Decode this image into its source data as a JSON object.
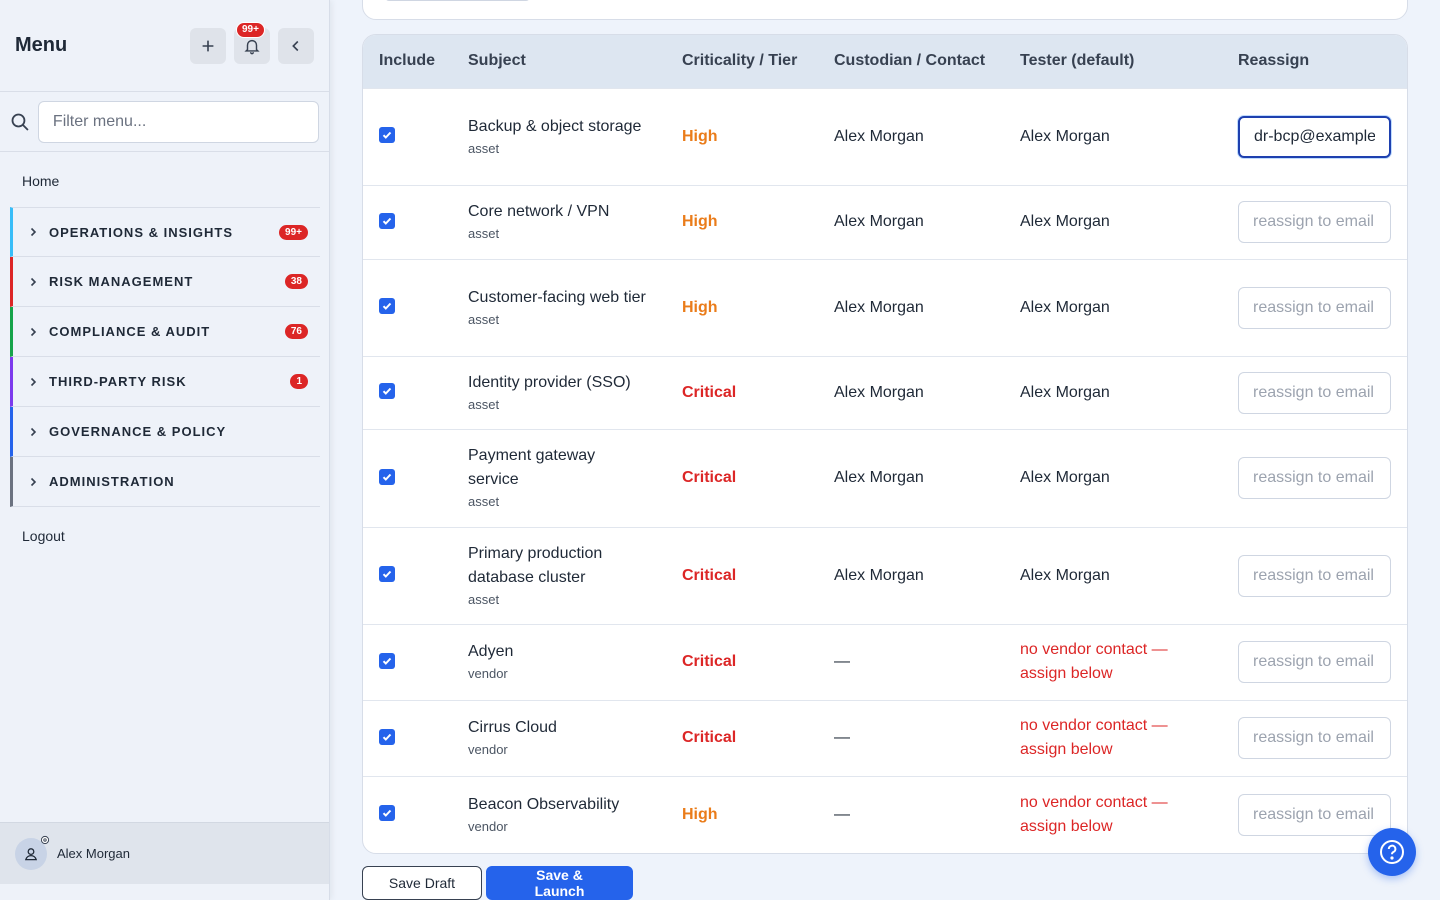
{
  "sidebar": {
    "title": "Menu",
    "notification_badge": "99+",
    "search_placeholder": "Filter menu...",
    "home_label": "Home",
    "logout_label": "Logout",
    "groups": [
      {
        "label": "OPERATIONS & INSIGHTS",
        "badge": "99+",
        "color": "#38bdf8"
      },
      {
        "label": "RISK MANAGEMENT",
        "badge": "38",
        "color": "#dc2626"
      },
      {
        "label": "COMPLIANCE & AUDIT",
        "badge": "76",
        "color": "#16a34a"
      },
      {
        "label": "THIRD-PARTY RISK",
        "badge": "1",
        "color": "#7c3aed"
      },
      {
        "label": "GOVERNANCE & POLICY",
        "badge": "",
        "color": "#2563eb"
      },
      {
        "label": "ADMINISTRATION",
        "badge": "",
        "color": "#6b7280"
      }
    ],
    "user_name": "Alex Morgan"
  },
  "table": {
    "headers": [
      "Include",
      "Subject",
      "Criticality / Tier",
      "Custodian / Contact",
      "Tester (default)",
      "Reassign"
    ],
    "reassign_placeholder": "reassign to email",
    "rows": [
      {
        "included": true,
        "subject": "Backup & object storage",
        "type": "asset",
        "tier": "High",
        "custodian": "Alex Morgan",
        "tester": "Alex Morgan",
        "tester_warning": false,
        "reassign_value": "dr-bcp@example.com"
      },
      {
        "included": true,
        "subject": "Core network / VPN",
        "type": "asset",
        "tier": "High",
        "custodian": "Alex Morgan",
        "tester": "Alex Morgan",
        "tester_warning": false,
        "reassign_value": ""
      },
      {
        "included": true,
        "subject": "Customer-facing web tier",
        "type": "asset",
        "tier": "High",
        "custodian": "Alex Morgan",
        "tester": "Alex Morgan",
        "tester_warning": false,
        "reassign_value": ""
      },
      {
        "included": true,
        "subject": "Identity provider (SSO)",
        "type": "asset",
        "tier": "Critical",
        "custodian": "Alex Morgan",
        "tester": "Alex Morgan",
        "tester_warning": false,
        "reassign_value": ""
      },
      {
        "included": true,
        "subject": "Payment gateway service",
        "type": "asset",
        "tier": "Critical",
        "custodian": "Alex Morgan",
        "tester": "Alex Morgan",
        "tester_warning": false,
        "reassign_value": ""
      },
      {
        "included": true,
        "subject": "Primary production database cluster",
        "type": "asset",
        "tier": "Critical",
        "custodian": "Alex Morgan",
        "tester": "Alex Morgan",
        "tester_warning": false,
        "reassign_value": ""
      },
      {
        "included": true,
        "subject": "Adyen",
        "type": "vendor",
        "tier": "Critical",
        "custodian": "—",
        "tester": "no vendor contact — assign below",
        "tester_warning": true,
        "reassign_value": ""
      },
      {
        "included": true,
        "subject": "Cirrus Cloud",
        "type": "vendor",
        "tier": "Critical",
        "custodian": "—",
        "tester": "no vendor contact — assign below",
        "tester_warning": true,
        "reassign_value": ""
      },
      {
        "included": true,
        "subject": "Beacon Observability",
        "type": "vendor",
        "tier": "High",
        "custodian": "—",
        "tester": "no vendor contact — assign below",
        "tester_warning": true,
        "reassign_value": ""
      }
    ]
  },
  "actions": {
    "save_draft": "Save Draft",
    "save_launch": "Save & Launch"
  },
  "colors": {
    "accent": "#2563eb",
    "high": "#ea7c1a",
    "critical": "#dc2626"
  }
}
